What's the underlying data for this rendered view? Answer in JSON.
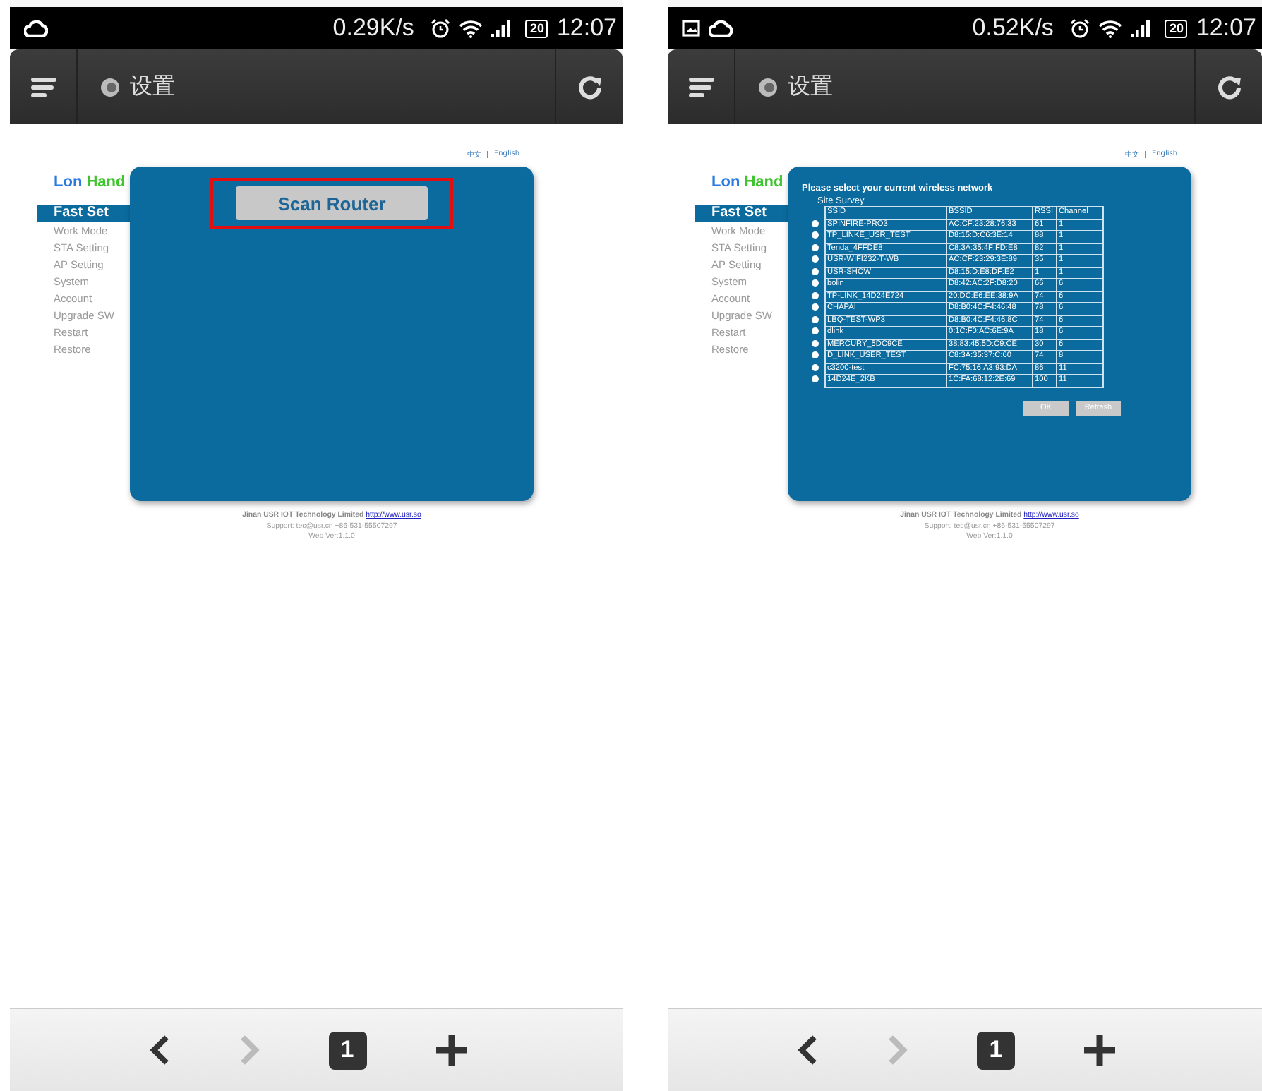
{
  "screens": [
    {
      "status_bar": {
        "notification_icons": [
          {
            "kind": "cloud"
          }
        ],
        "speed": "0.29K/s",
        "battery": "20",
        "time": "12:07"
      },
      "app_bar": {
        "title": "设置"
      },
      "page": {
        "languages": [
          "中文",
          "English"
        ],
        "logo": {
          "first": "Lon",
          "second": "Hand"
        },
        "menu": [
          {
            "label": "Fast Set",
            "selected": true
          },
          {
            "label": "Work Mode",
            "selected": false
          },
          {
            "label": "STA Setting",
            "selected": false
          },
          {
            "label": "AP Setting",
            "selected": false
          },
          {
            "label": "System",
            "selected": false
          },
          {
            "label": "Account",
            "selected": false
          },
          {
            "label": "Upgrade SW",
            "selected": false
          },
          {
            "label": "Restart",
            "selected": false
          },
          {
            "label": "Restore",
            "selected": false
          }
        ],
        "panel": {
          "kind": "scan",
          "scan_button": {
            "label": "Scan Router",
            "highlighted": true
          }
        },
        "footer": {
          "company": "Jinan USR IOT Technology Limited",
          "link": "http://www.usr.so",
          "support": "Support: tec@usr.cn +86-531-55507297",
          "version": "Web Ver:1.1.0"
        }
      },
      "bottom_bar": {
        "back_disabled": false,
        "forward_disabled": true,
        "tab_count": "1"
      }
    },
    {
      "status_bar": {
        "notification_icons": [
          {
            "kind": "image"
          },
          {
            "kind": "cloud"
          }
        ],
        "speed": "0.52K/s",
        "battery": "20",
        "time": "12:07"
      },
      "app_bar": {
        "title": "设置"
      },
      "page": {
        "languages": [
          "中文",
          "English"
        ],
        "logo": {
          "first": "Lon",
          "second": "Hand"
        },
        "menu": [
          {
            "label": "Fast Set",
            "selected": true
          },
          {
            "label": "Work Mode",
            "selected": false
          },
          {
            "label": "STA Setting",
            "selected": false
          },
          {
            "label": "AP Setting",
            "selected": false
          },
          {
            "label": "System",
            "selected": false
          },
          {
            "label": "Account",
            "selected": false
          },
          {
            "label": "Upgrade SW",
            "selected": false
          },
          {
            "label": "Restart",
            "selected": false
          },
          {
            "label": "Restore",
            "selected": false
          }
        ],
        "panel": {
          "kind": "survey",
          "title": "Please select your current wireless network",
          "subtitle": "Site Survey",
          "columns": [
            "SSID",
            "BSSID",
            "RSSI",
            "Channel"
          ],
          "rows": [
            {
              "selected": false,
              "cells": [
                "SPINFIRE-PRO3",
                "AC:CF:23:28:76:33",
                "61",
                "1"
              ]
            },
            {
              "selected": false,
              "cells": [
                "TP_LINKE_USR_TEST",
                "D8:15:D:C6:3E:14",
                "88",
                "1"
              ]
            },
            {
              "selected": false,
              "cells": [
                "Tenda_4FFDE8",
                "C8:3A:35:4F:FD:E8",
                "82",
                "1"
              ]
            },
            {
              "selected": false,
              "cells": [
                "USR-WIFI232-T-WB",
                "AC:CF:23:29:3E:89",
                "35",
                "1"
              ]
            },
            {
              "selected": false,
              "cells": [
                "USR-SHOW",
                "D8:15:D:E8:DF:E2",
                "1",
                "1"
              ]
            },
            {
              "selected": false,
              "cells": [
                "bolin",
                "D8:42:AC:2F:D8:20",
                "66",
                "6"
              ]
            },
            {
              "selected": false,
              "cells": [
                "TP-LINK_14D24E724",
                "20:DC:E6:EE:38:9A",
                "74",
                "6"
              ]
            },
            {
              "selected": false,
              "cells": [
                "CHAPAI",
                "D8:B0:4C:F4:46:48",
                "78",
                "6"
              ]
            },
            {
              "selected": false,
              "cells": [
                "LBQ-TEST-WP3",
                "D8:B0:4C:F4:46:8C",
                "74",
                "6"
              ]
            },
            {
              "selected": false,
              "cells": [
                "dlink",
                "0:1C:F0:AC:6E:9A",
                "18",
                "6"
              ]
            },
            {
              "selected": false,
              "cells": [
                "MERCURY_5DC9CE",
                "38:83:45:5D:C9:CE",
                "30",
                "6"
              ]
            },
            {
              "selected": false,
              "cells": [
                "D_LINK_USER_TEST",
                "C8:3A:35:37:C:60",
                "74",
                "8"
              ]
            },
            {
              "selected": false,
              "cells": [
                "c3200-test",
                "FC:75:16:A3:93:DA",
                "86",
                "11"
              ]
            },
            {
              "selected": false,
              "cells": [
                "14D24E_2KB",
                "1C:FA:68:12:2E:69",
                "100",
                "11"
              ]
            }
          ],
          "buttons": [
            "OK",
            "Refresh"
          ]
        },
        "footer": {
          "company": "Jinan USR IOT Technology Limited",
          "link": "http://www.usr.so",
          "support": "Support: tec@usr.cn +86-531-55507297",
          "version": "Web Ver:1.1.0"
        }
      },
      "bottom_bar": {
        "back_disabled": false,
        "forward_disabled": true,
        "tab_count": "1"
      }
    }
  ]
}
